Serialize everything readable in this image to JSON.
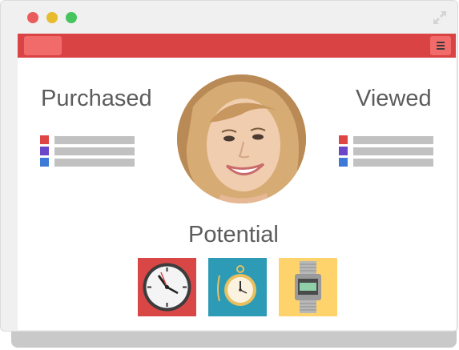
{
  "window": {
    "controls": [
      "close",
      "minimize",
      "maximize"
    ],
    "expand_icon": "expand-arrows-icon",
    "toolbar": {
      "accent": "#d94343",
      "button_color": "#f26b6b",
      "menu_icon": "hamburger-menu-icon"
    }
  },
  "main": {
    "purchased_title": "Purchased",
    "viewed_title": "Viewed",
    "potential_title": "Potential",
    "list_colors": [
      "#e04545",
      "#6a46c9",
      "#3d7ad8"
    ],
    "profile_photo": "smiling-woman-photo",
    "products": [
      {
        "name": "wall-clock",
        "bg": "#d94646"
      },
      {
        "name": "pocket-watch",
        "bg": "#2d9bb5"
      },
      {
        "name": "digital-wristwatch",
        "bg": "#ffd36b"
      }
    ]
  }
}
